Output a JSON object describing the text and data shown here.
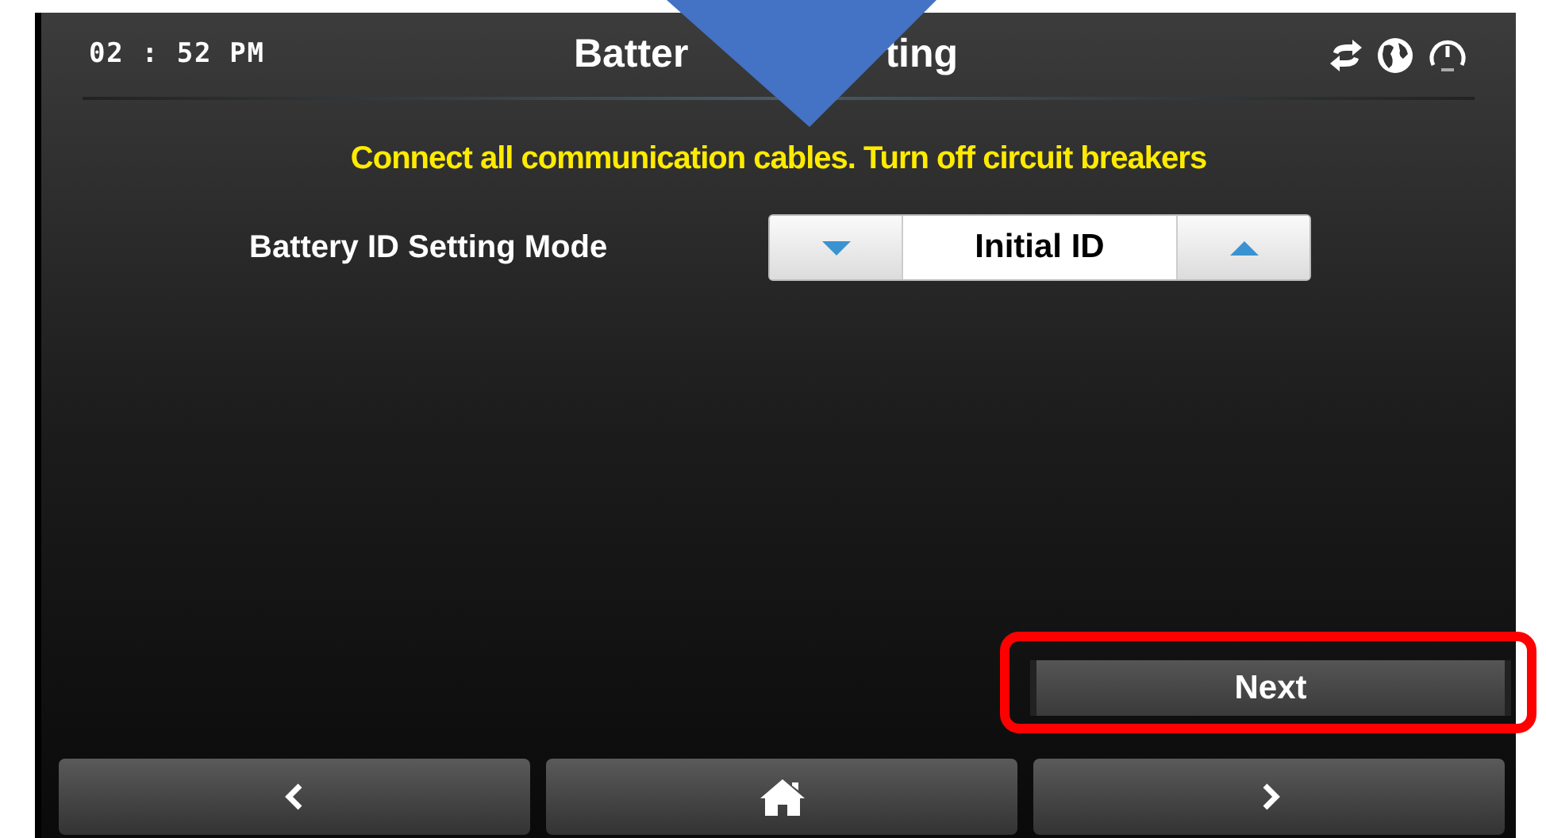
{
  "status_bar": {
    "time": "02 : 52 PM",
    "title_parts": [
      "Batter",
      "ting"
    ]
  },
  "warning": "Connect all communication cables. Turn off circuit breakers",
  "setting": {
    "label": "Battery ID Setting Mode",
    "value": "Initial ID"
  },
  "next_button": {
    "label": "Next",
    "highlighted": true
  },
  "nav_buttons": [
    {
      "kind": "back"
    },
    {
      "kind": "home"
    },
    {
      "kind": "forward"
    }
  ]
}
